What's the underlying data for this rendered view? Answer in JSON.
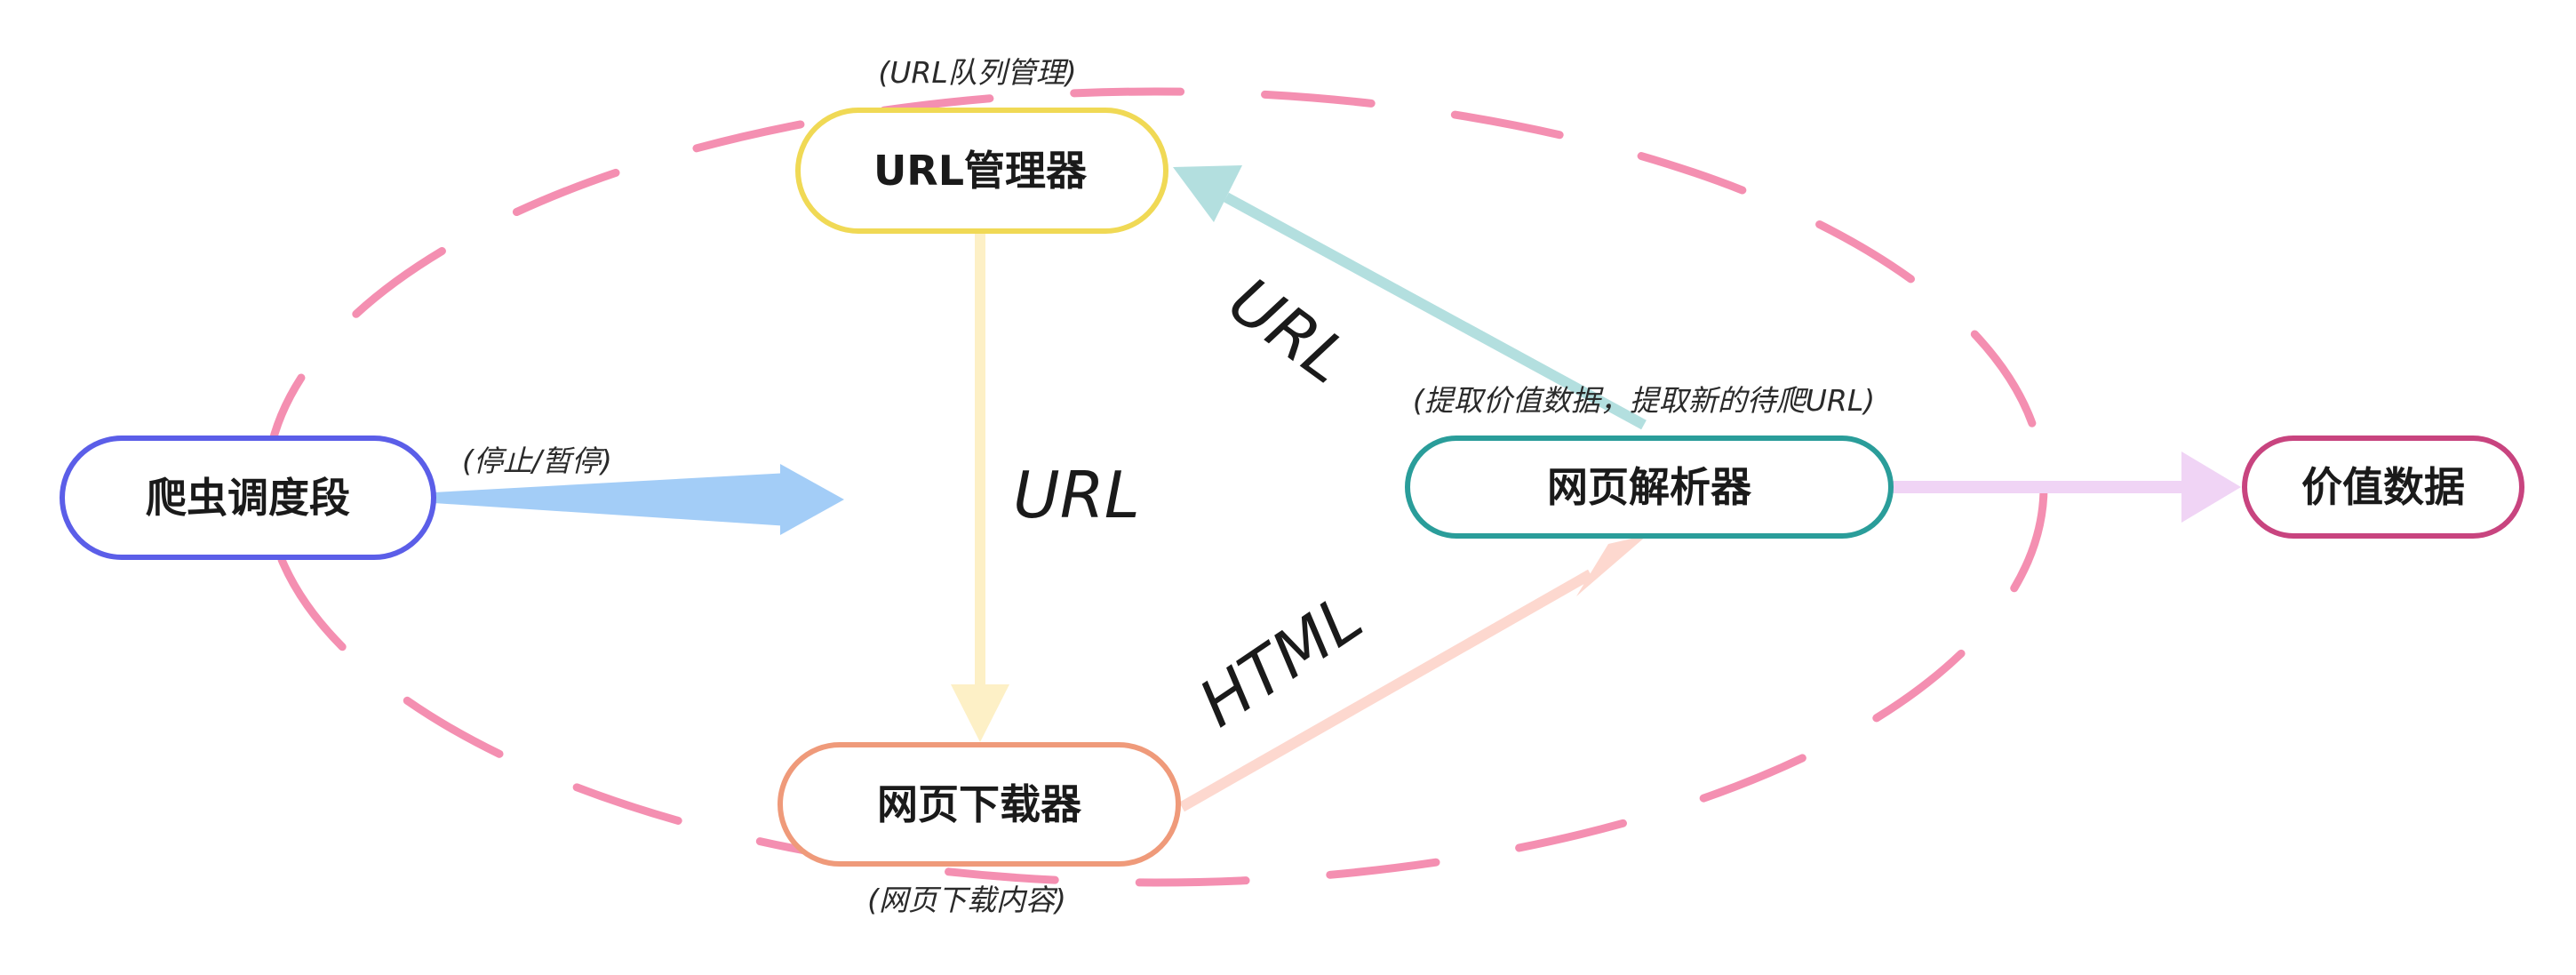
{
  "diagram": {
    "nodes": {
      "scheduler": {
        "label": "爬虫调度段",
        "note": "(停止/暂停)",
        "color": "#5b5ee8"
      },
      "url_manager": {
        "label": "URL管理器",
        "note": "(URL队列管理)",
        "color": "#f0d955"
      },
      "downloader": {
        "label": "网页下载器",
        "note": "(网页下载内容)",
        "color": "#ef9a7a"
      },
      "parser": {
        "label": "网页解析器",
        "note": "(提取价值数据，提取新的待爬URL)",
        "color": "#2a9d9a"
      },
      "value_data": {
        "label": "价值数据",
        "color": "#c8447f"
      }
    },
    "edges": {
      "url_down": {
        "label": "URL",
        "color": "#fdf0c6"
      },
      "url_back": {
        "label": "URL",
        "color": "#b3dfdf"
      },
      "html": {
        "label": "HTML",
        "color": "#fdd8cf"
      },
      "start": {
        "color": "#a3cdf7"
      },
      "output": {
        "color": "#f0d4f5"
      }
    },
    "boundary_color": "#f48fb1"
  }
}
